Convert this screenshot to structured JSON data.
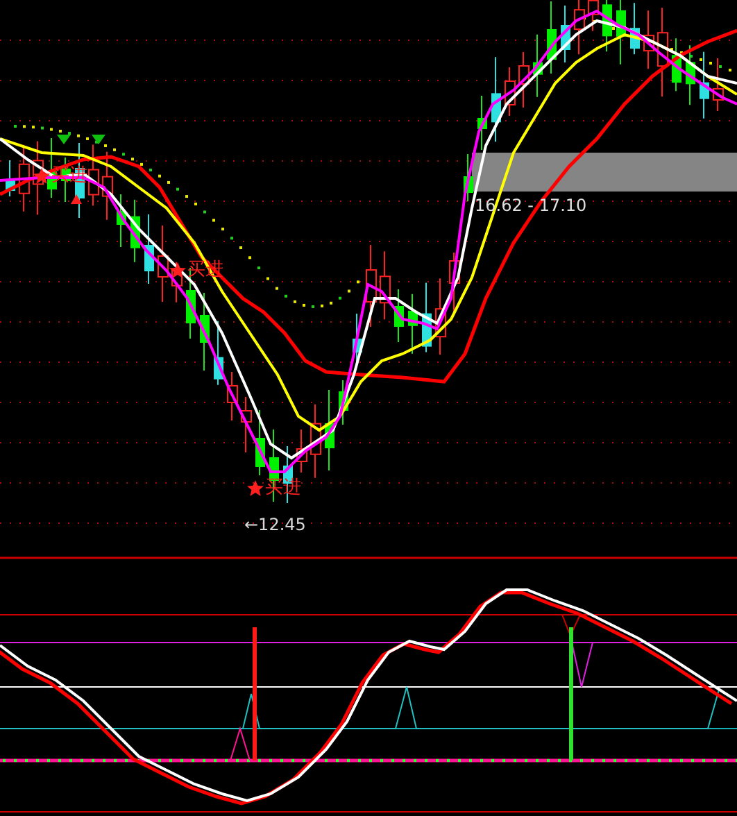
{
  "main_chart": {
    "signals": [
      {
        "label": "买进"
      },
      {
        "label": "买进"
      },
      {
        "label": "买进"
      }
    ],
    "low_price_label": "←12.45",
    "range_label": "16.62 - 17.10"
  }
}
